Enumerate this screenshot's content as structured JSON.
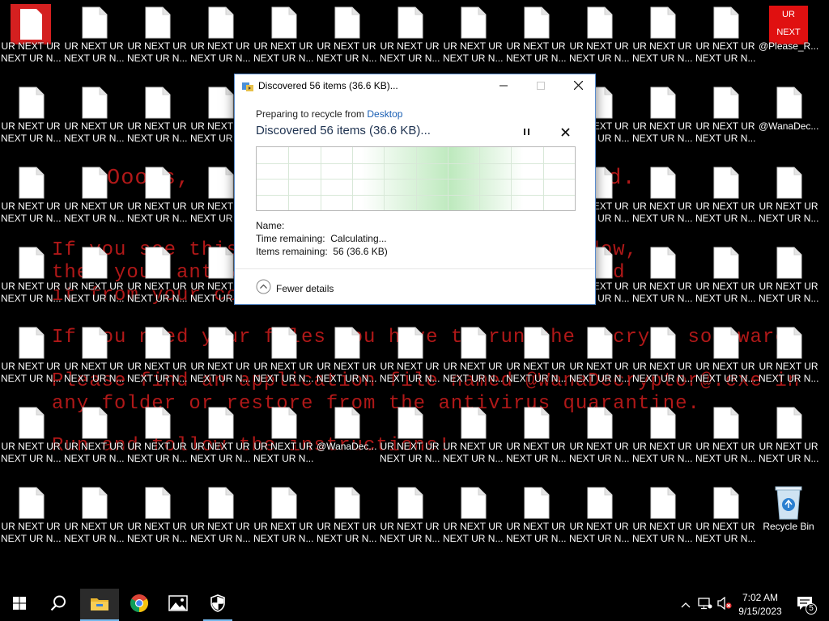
{
  "wallpaper": {
    "line_title": "Ooops,                          ypted.",
    "line1": "If you see this                 rypt0r\" window,",
    "line2": "then your antivi                or you deleted",
    "line3": "it from your computer.",
    "line4": "If you need your files you have to run the decrypt software.",
    "line5a": "Please find an application file named",
    "line5b": "@WanaDecryptor@.exe",
    "line5c": "in",
    "line6": "any folder or restore from the antivirus quarantine.",
    "line7": "Run and follow the instructions!"
  },
  "desktop": {
    "icon_label_1": "UR NEXT UR",
    "icon_label_2": "NEXT UR N...",
    "special": {
      "ransom_file": {
        "line1": "UR NEXT UR",
        "line2": "NEXT UR N..."
      },
      "ransom_note": {
        "line1": "@Please_R...",
        "line2": ""
      },
      "decryptor": {
        "line1": "@WanaDec...",
        "line2": ""
      },
      "decryptor2": {
        "line1": "@WanaDec...",
        "line2": ""
      },
      "recycle_bin": {
        "line1": "Recycle Bin",
        "line2": ""
      },
      "ur_next_tile": {
        "line1": "UR",
        "line2": "NEXT"
      }
    }
  },
  "dialog": {
    "title": "Discovered 56 items (36.6 KB)...",
    "subtitle_prefix": "Preparing to recycle from ",
    "subtitle_link": "Desktop",
    "main_status": "Discovered 56 items (36.6 KB)...",
    "name_label": "Name:",
    "name_value": "",
    "time_label": "Time remaining:",
    "time_value": "Calculating...",
    "items_label": "Items remaining:",
    "items_value": "56 (36.6 KB)",
    "details_toggle": "Fewer details",
    "progress_highlight_fraction": 0.66
  },
  "taskbar": {
    "items": [
      "start-icon",
      "search-icon",
      "file-explorer-icon",
      "chrome-icon",
      "photos-icon",
      "windows-security-icon"
    ],
    "clock_time": "7:02 AM",
    "clock_date": "9/15/2023",
    "notification_count": "5"
  },
  "colors": {
    "accent": "#76b9ed",
    "wallpaper_red": "#b01818",
    "dialog_title_text": "#1e3250",
    "link": "#1a5fb4",
    "graph_green": "#6fcf6f"
  }
}
